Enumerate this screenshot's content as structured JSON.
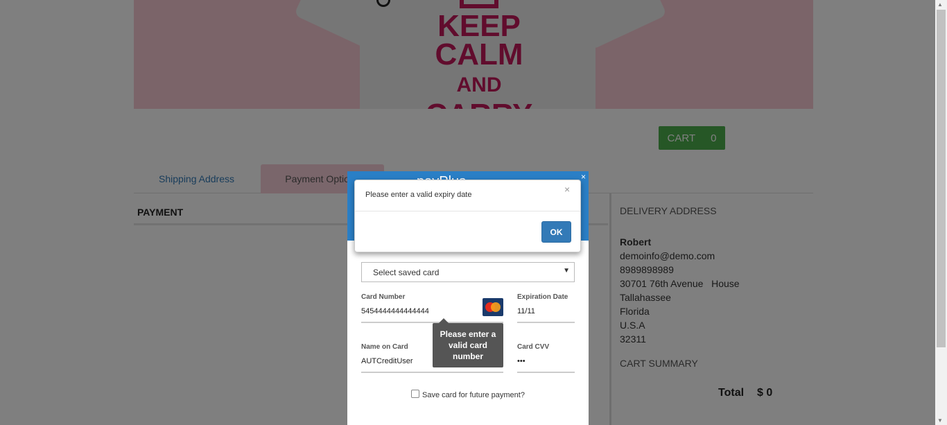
{
  "banner": {
    "line1": "KEEP",
    "line2": "CALM",
    "line3": "AND",
    "line4": "CARRY"
  },
  "cart": {
    "label": "CART",
    "count": "0"
  },
  "tabs": [
    {
      "label": "Shipping Address"
    },
    {
      "label": "Payment Options"
    }
  ],
  "payment": {
    "title": "PAYMENT"
  },
  "delivery": {
    "heading": "DELIVERY ADDRESS",
    "name": "Robert",
    "email": "demoinfo@demo.com",
    "phone": "8989898989",
    "street": "30701 76th Avenue   House",
    "city": "Tallahassee",
    "state": "Florida",
    "country": "U.S.A",
    "zip": "32311"
  },
  "cart_summary": {
    "heading": "CART SUMMARY",
    "total_label": "Total",
    "total_value": "$ 0"
  },
  "pay_modal": {
    "brand": "payPlus",
    "close": "×",
    "saved_card_placeholder": "Select saved card",
    "card_number_label": "Card Number",
    "card_number_value": "5454444444444444",
    "card_brand": "mastercard",
    "expiry_label": "Expiration Date",
    "expiry_value": "11/11",
    "name_label": "Name on Card",
    "name_value": "AUTCreditUser",
    "cvv_label": "Card CVV",
    "cvv_value": "•••",
    "save_card_label": "Save card for future payment?",
    "tooltip": "Please enter a valid card number"
  },
  "alert": {
    "message": "Please enter a valid expiry date",
    "close": "×",
    "ok_label": "OK"
  },
  "colors": {
    "cart_green": "#4cae4c",
    "modal_blue": "#2a7fc6",
    "ok_blue": "#337ab7",
    "banner_pink": "#f7c8d2",
    "brand_magenta": "#c2185b"
  }
}
